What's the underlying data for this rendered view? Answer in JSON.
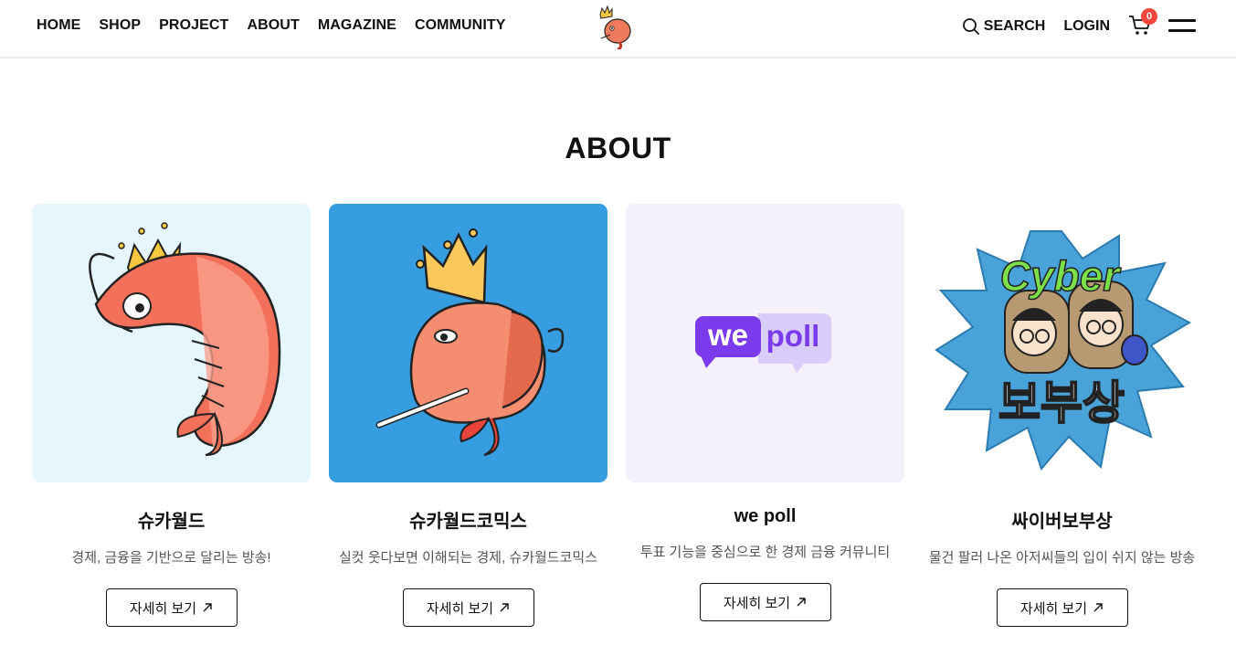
{
  "nav": {
    "items": [
      "HOME",
      "SHOP",
      "PROJECT",
      "ABOUT",
      "MAGAZINE",
      "COMMUNITY"
    ],
    "search_label": "SEARCH",
    "login_label": "LOGIN",
    "cart_count": "0"
  },
  "section": {
    "title": "ABOUT"
  },
  "cards": [
    {
      "name": "슈카월드",
      "desc": "경제, 금융을 기반으로 달리는 방송!",
      "button": "자세히 보기",
      "bg": "#e6f6fd",
      "image": "shrimp-crown-illustration"
    },
    {
      "name": "슈카월드코믹스",
      "desc": "실컷 웃다보면 이해되는 경제, 슈카월드코믹스",
      "button": "자세히 보기",
      "bg": "#369de0",
      "image": "shrimp-cigarette-illustration"
    },
    {
      "name": "we poll",
      "desc": "투표 기능을 중심으로 한 경제 금융 커뮤니티",
      "button": "자세히 보기",
      "bg": "#f4f1fd",
      "image": "wepoll-logo",
      "logo_text_1": "we",
      "logo_text_2": "poll"
    },
    {
      "name": "싸이버보부상",
      "desc": "물건 팔러 나온 아저씨들의 입이 쉬지 않는 방송",
      "button": "자세히 보기",
      "bg": "#ffffff",
      "image": "cyber-bobusang-illustration",
      "logo_text_1": "Cyber",
      "logo_text_2": "보부상"
    }
  ],
  "colors": {
    "accent_badge": "#f5473d",
    "wepoll_purple": "#7c3aed"
  }
}
